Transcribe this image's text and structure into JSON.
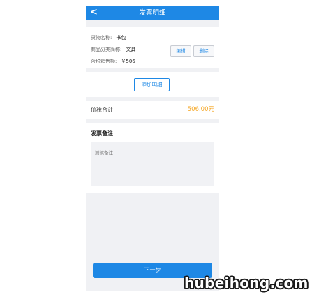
{
  "header": {
    "back_icon": "chevron-left-icon",
    "back_glyph": "<",
    "title": "发票明细"
  },
  "item": {
    "goods_name_label": "货物名称:",
    "goods_name_value": "书包",
    "category_label": "商品分类简称:",
    "category_value": "文具",
    "price_label": "含税销售额:",
    "price_value": "￥506",
    "edit_label": "编辑",
    "delete_label": "删除"
  },
  "add_detail_label": "添加明细",
  "total": {
    "label": "价税合计",
    "amount": "506.00元"
  },
  "remark": {
    "heading": "发票备注",
    "placeholder": "测试备注"
  },
  "next_label": "下一步",
  "watermark": "hubeihong.com",
  "colors": {
    "primary": "#1e88e5",
    "amount": "#f5a623",
    "background": "#f0f1f4"
  }
}
